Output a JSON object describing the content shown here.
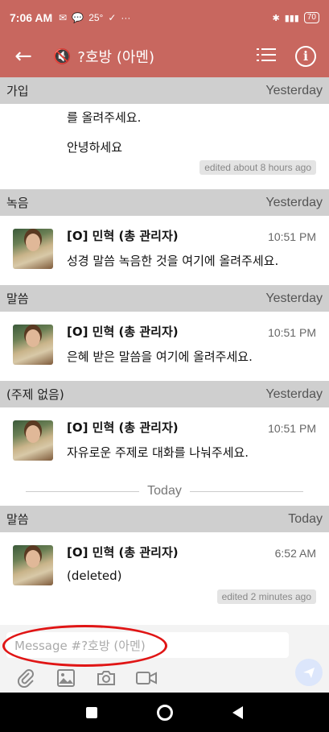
{
  "status_bar": {
    "time": "7:06 AM",
    "temperature": "25°",
    "battery": "70"
  },
  "app_bar": {
    "title": "?호방 (아멘)"
  },
  "feed": {
    "partial_message": {
      "lines": [
        "를 올려주세요.",
        "안녕하세요"
      ],
      "edited": "edited about 8 hours ago"
    },
    "topic_header_0": {
      "name": "가입",
      "when": "Yesterday"
    },
    "topic_header_1": {
      "name": "녹음",
      "when": "Yesterday"
    },
    "topic_header_2": {
      "name": "말씀",
      "when": "Yesterday"
    },
    "topic_header_3": {
      "name": "(주제 없음)",
      "when": "Yesterday"
    },
    "topic_header_4": {
      "name": "말씀",
      "when": "Today"
    },
    "messages": [
      {
        "sender": "[O] 민혁 (총 관리자)",
        "time": "10:51 PM",
        "body": "성경 말씀 녹음한 것을 여기에 올려주세요."
      },
      {
        "sender": "[O] 민혁 (총 관리자)",
        "time": "10:51 PM",
        "body": "은혜 받은 말씀을 여기에 올려주세요."
      },
      {
        "sender": "[O] 민혁 (총 관리자)",
        "time": "10:51 PM",
        "body": "자유로운 주제로 대화를 나눠주세요."
      },
      {
        "sender": "[O] 민혁 (총 관리자)",
        "time": "6:52 AM",
        "body": "(deleted)",
        "edited": "edited 2 minutes ago"
      }
    ],
    "date_divider": "Today"
  },
  "compose": {
    "placeholder": "Message #?호방 (아멘)"
  },
  "colors": {
    "app_bar": "#c8675f",
    "topic_header": "#cfcfcf",
    "highlight": "#e01515"
  }
}
